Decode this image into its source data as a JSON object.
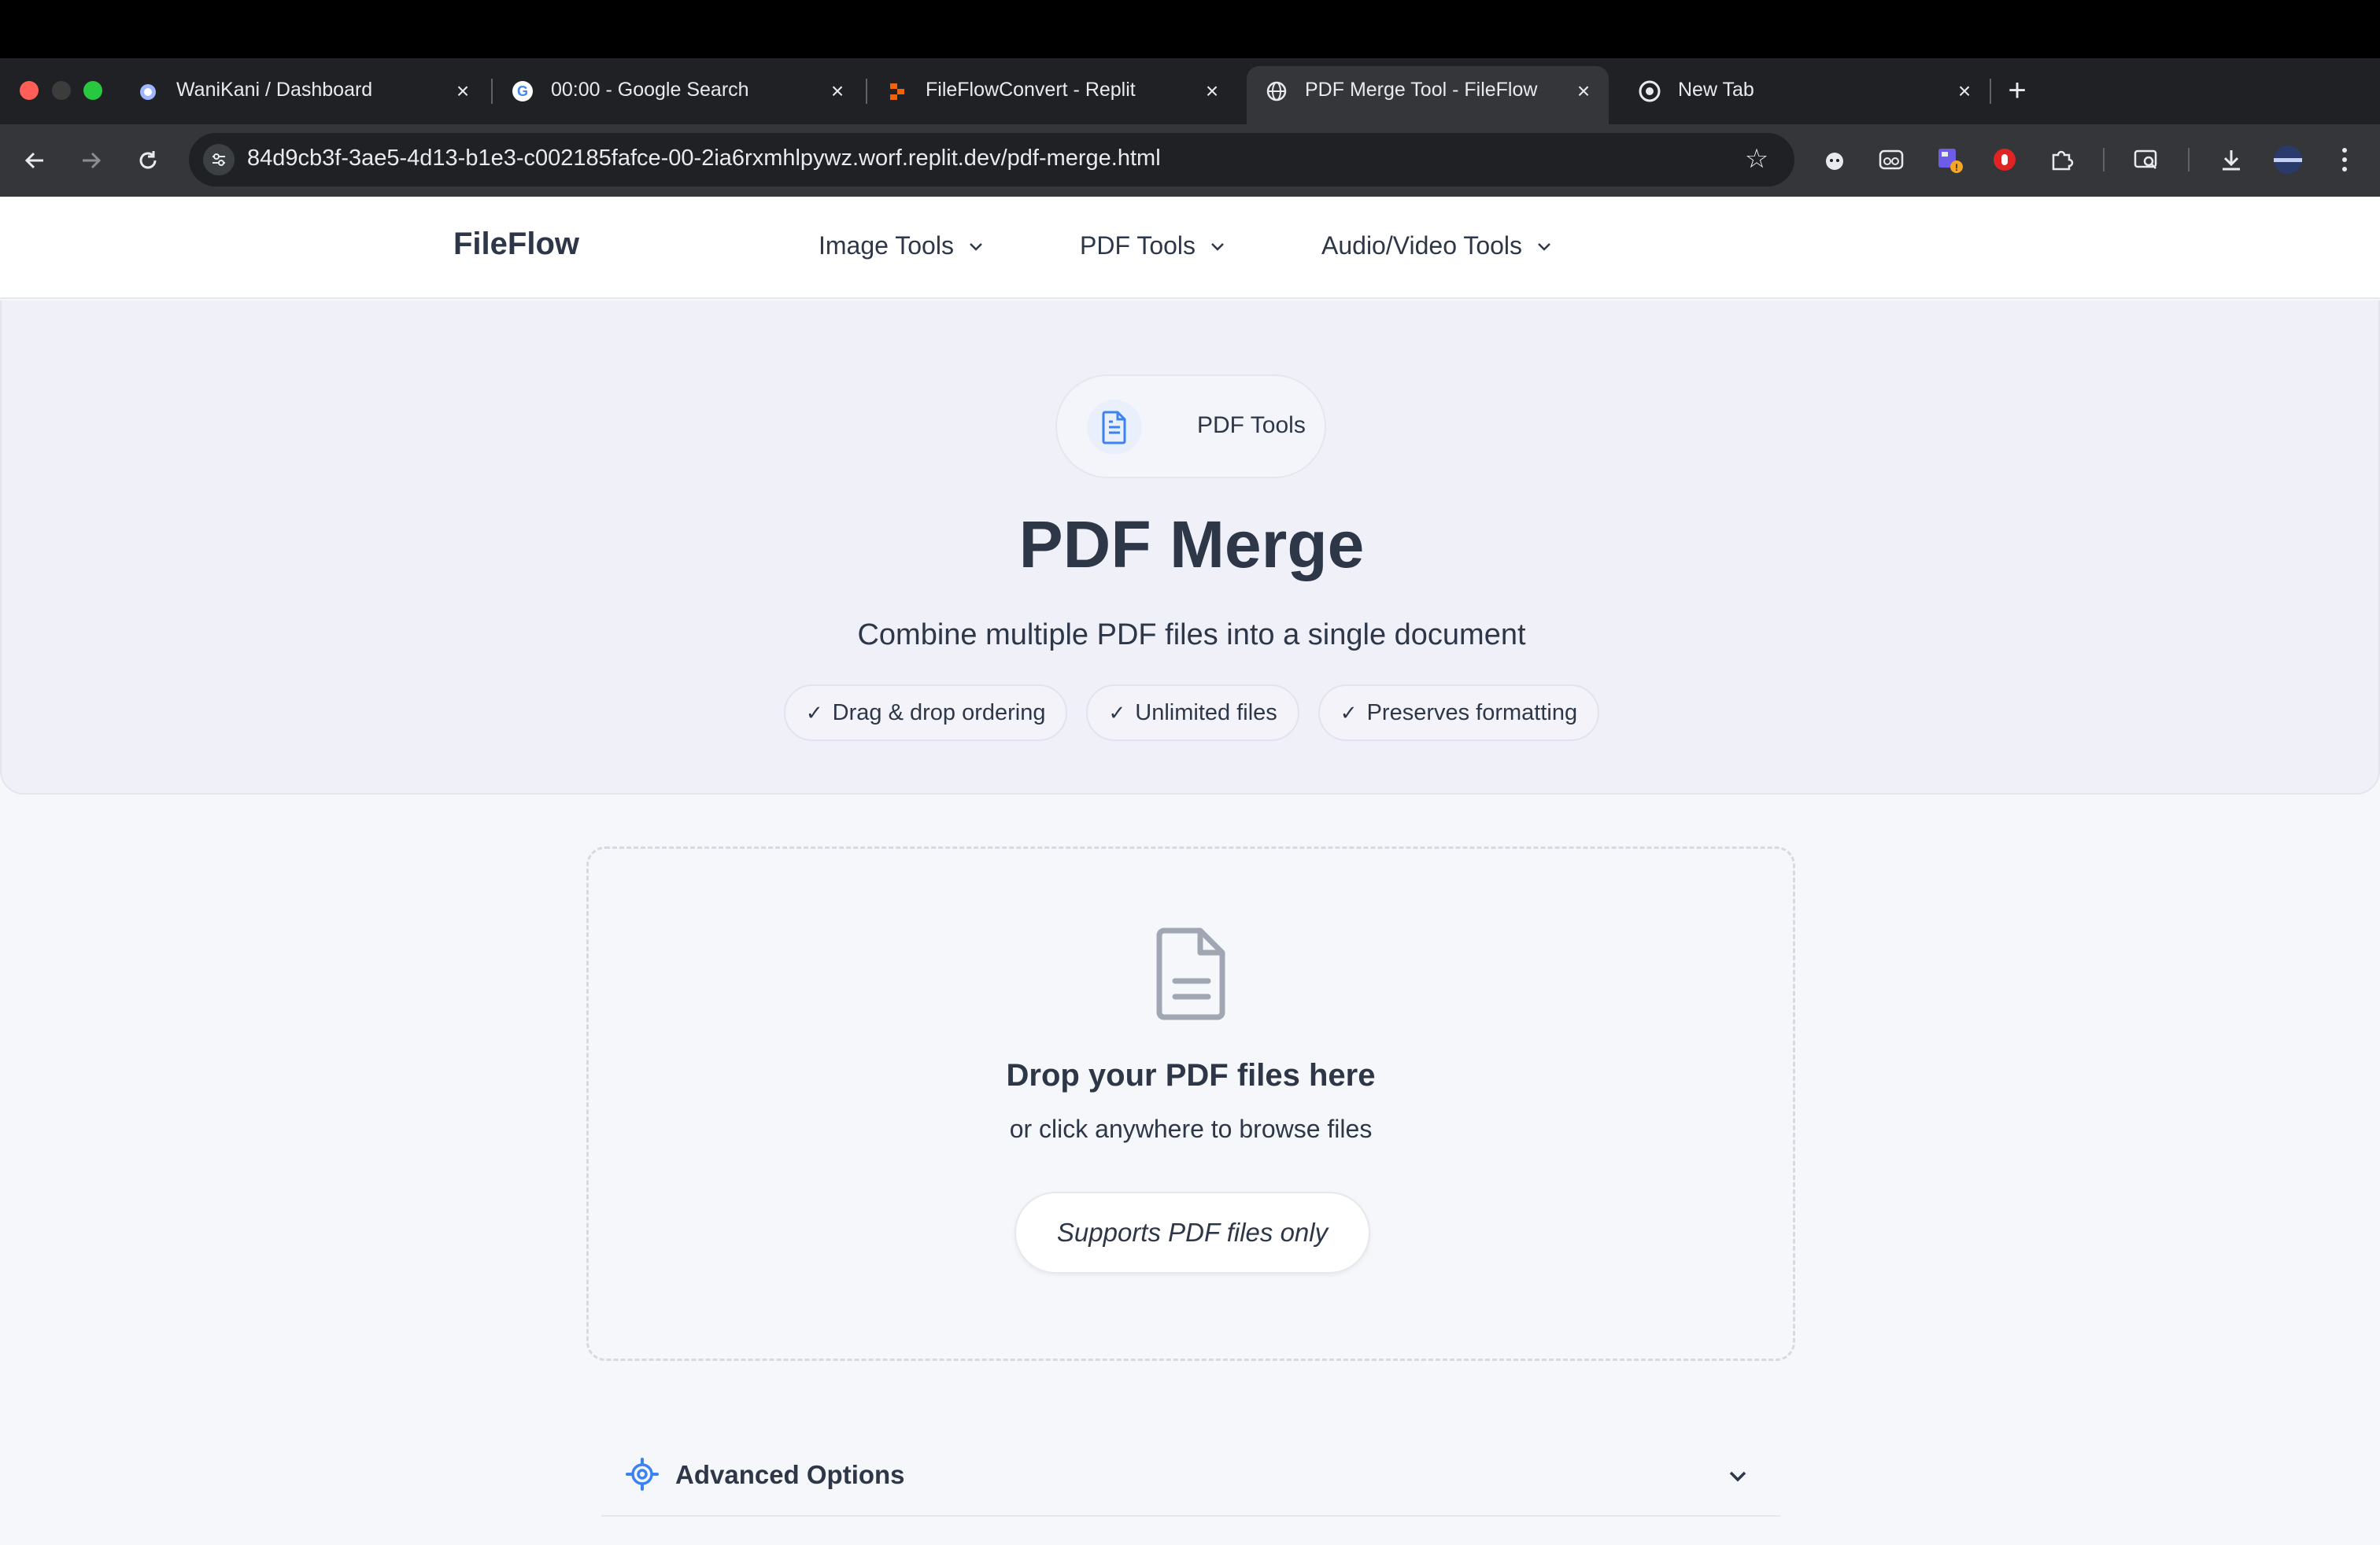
{
  "browser": {
    "tabs": [
      {
        "title": "WaniKani / Dashboard",
        "active": false,
        "favicon": "wanikani-icon"
      },
      {
        "title": "00:00 - Google Search",
        "active": false,
        "favicon": "google-icon"
      },
      {
        "title": "FileFlowConvert - Replit",
        "active": false,
        "favicon": "replit-icon"
      },
      {
        "title": "PDF Merge Tool - FileFlow",
        "active": true,
        "favicon": "globe-icon"
      },
      {
        "title": "New Tab",
        "active": false,
        "favicon": "chrome-icon"
      }
    ],
    "url": "84d9cb3f-3ae5-4d13-b1e3-c002185fafce-00-2ia6rxmhlpywz.worf.replit.dev/pdf-merge.html"
  },
  "nav": {
    "brand": "FileFlow",
    "links": [
      "Image Tools",
      "PDF Tools",
      "Audio/Video Tools"
    ]
  },
  "hero": {
    "category": "PDF Tools",
    "title": "PDF Merge",
    "subtitle": "Combine multiple PDF files into a single document",
    "features": [
      "Drag & drop ordering",
      "Unlimited files",
      "Preserves formatting"
    ]
  },
  "dropzone": {
    "title": "Drop your PDF files here",
    "subtitle": "or click anywhere to browse files",
    "badge": "Supports PDF files only"
  },
  "advanced": {
    "label": "Advanced Options"
  },
  "colors": {
    "accent": "#3b82f6",
    "text": "#2d3748",
    "hero_bg": "#f0f0f8"
  }
}
